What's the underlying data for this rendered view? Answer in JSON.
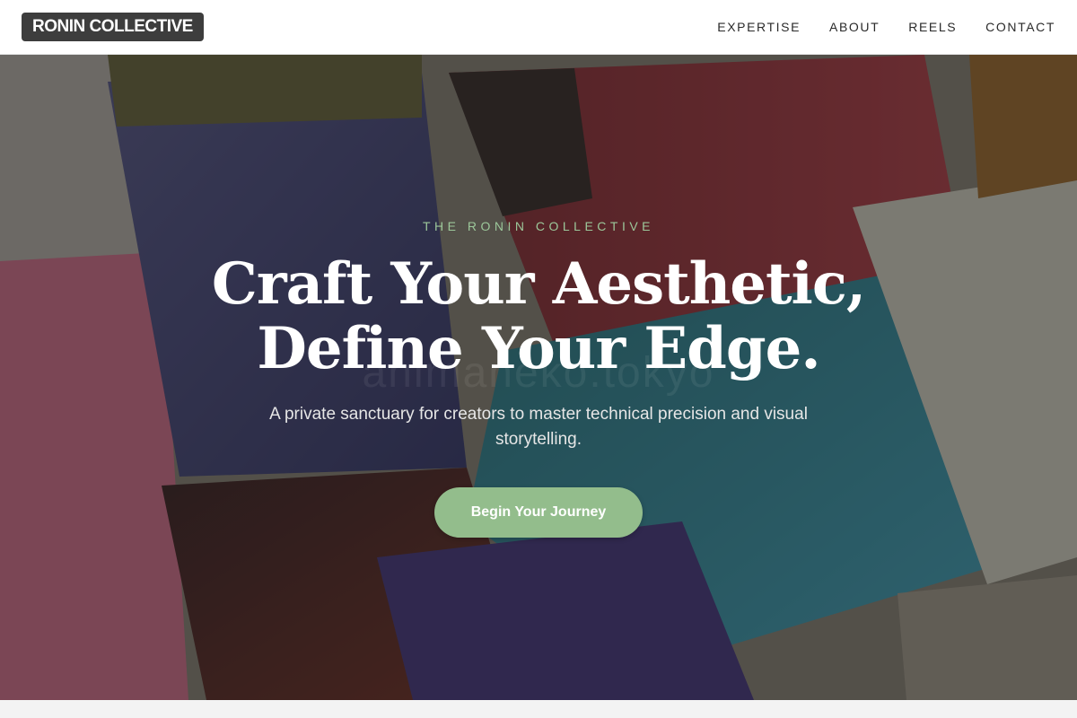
{
  "header": {
    "logo_text": "RONIN COLLECTIVE",
    "nav": [
      {
        "label": "EXPERTISE"
      },
      {
        "label": "ABOUT"
      },
      {
        "label": "REELS"
      },
      {
        "label": "CONTACT"
      }
    ]
  },
  "hero": {
    "eyebrow": "THE RONIN COLLECTIVE",
    "headline_line1": "Craft Your Aesthetic,",
    "headline_line2": "Define Your Edge.",
    "subheading": "A private sanctuary for creators to master technical precision and visual storytelling.",
    "cta_label": "Begin Your Journey",
    "background_image": "paintbrushes-photo",
    "watermark_text": "animaneko.tokyo"
  },
  "colors": {
    "accent": "#93bd8c",
    "eyebrow": "#9cc79a",
    "logo_bg": "#3d3d3d"
  }
}
